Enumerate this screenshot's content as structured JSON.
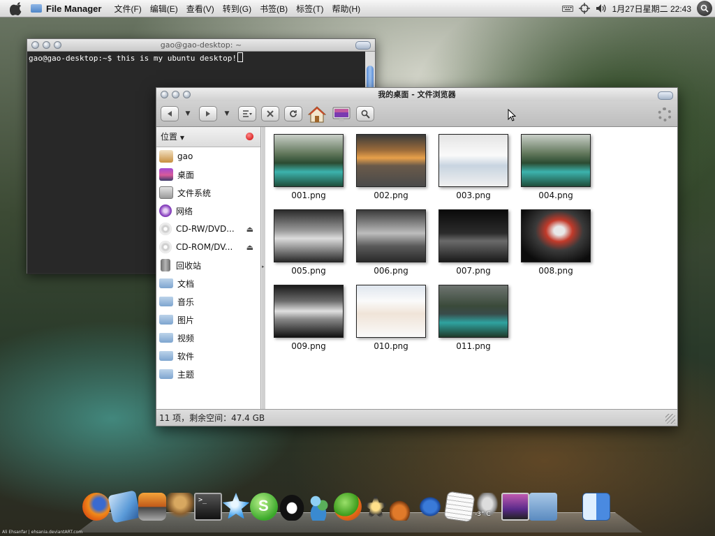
{
  "menubar": {
    "app_name": "File Manager",
    "menus": [
      "文件(F)",
      "编辑(E)",
      "查看(V)",
      "转到(G)",
      "书签(B)",
      "标签(T)",
      "帮助(H)"
    ],
    "clock": "1月27日星期二 22:43"
  },
  "terminal": {
    "title": "gao@gao-desktop: ~",
    "prompt": "gao@gao-desktop:~$ ",
    "command": "this is my ubuntu desktop!"
  },
  "file_manager": {
    "title": "我的桌面 - 文件浏览器",
    "sidebar_header": "位置",
    "places": [
      {
        "label": "gao",
        "icon": "home-icon"
      },
      {
        "label": "桌面",
        "icon": "desktop-icon"
      },
      {
        "label": "文件系统",
        "icon": "filesystem-icon"
      },
      {
        "label": "网络",
        "icon": "network-icon"
      },
      {
        "label": "CD-RW/DVD...",
        "icon": "cd-icon",
        "eject": true
      },
      {
        "label": "CD-ROM/DV...",
        "icon": "cd-icon",
        "eject": true
      },
      {
        "label": "回收站",
        "icon": "trash-icon"
      },
      {
        "label": "文档",
        "icon": "folder-icon"
      },
      {
        "label": "音乐",
        "icon": "folder-icon"
      },
      {
        "label": "图片",
        "icon": "folder-icon"
      },
      {
        "label": "视频",
        "icon": "folder-icon"
      },
      {
        "label": "软件",
        "icon": "folder-icon"
      },
      {
        "label": "主题",
        "icon": "folder-icon"
      }
    ],
    "files": [
      {
        "name": "001.png",
        "thumb": "lake"
      },
      {
        "name": "002.png",
        "thumb": "sunset"
      },
      {
        "name": "003.png",
        "thumb": "screen"
      },
      {
        "name": "004.png",
        "thumb": "lake"
      },
      {
        "name": "005.png",
        "thumb": "3d"
      },
      {
        "name": "006.png",
        "thumb": "screen"
      },
      {
        "name": "007.png",
        "thumb": "dark"
      },
      {
        "name": "008.png",
        "thumb": "red"
      },
      {
        "name": "009.png",
        "thumb": "3d"
      },
      {
        "name": "010.png",
        "thumb": "ubuntu"
      },
      {
        "name": "011.png",
        "thumb": "lakedark"
      }
    ],
    "status": "11 项，剩余空间：47.4 GB"
  },
  "dock": {
    "apps": [
      "firefox-icon",
      "mail-icon",
      "photo-icon",
      "gimp-icon",
      "terminal-icon",
      "chat-icon",
      "skype-icon",
      "qq-icon",
      "messenger-icon",
      "amsn-icon",
      "star-icon",
      "guitar-icon",
      "writer-icon",
      "text-editor-icon",
      "weather-icon",
      "monitor-icon",
      "apps-folder-icon",
      "finder-icon"
    ],
    "weather_temp": "-3° C"
  },
  "credit": "Ali Ehsanfar | ehsania.deviantART.com"
}
